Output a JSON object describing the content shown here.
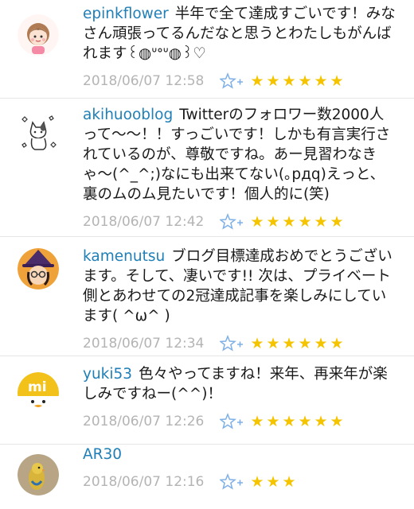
{
  "comments": [
    {
      "user": "epinkflower",
      "text": "半年で全て達成すごいです！みなさん頑張ってるんだなと思うとわたしもがんばれます꒰◍ᐡᐤᐡ◍꒱♡",
      "date": "2018/06/07 12:58",
      "stars": 6,
      "avatar_icon": "cartoon-girl-avatar"
    },
    {
      "user": "akihuooblog",
      "text": "Twitterのフォロワー数2000人って〜〜！！すっごいです！しかも有言実行されているのが、尊敬ですね。あー見習わなきゃ〜(^_^;)なにも出来てない(｡pдq)えっと、裏のムのム見たいです！個人的に(笑)",
      "date": "2018/06/07 12:42",
      "stars": 6,
      "avatar_icon": "cat-doodle-avatar"
    },
    {
      "user": "kamenutsu",
      "text": "ブログ目標達成おめでとうございます。そして、凄いです!! 次は、プライベート側とあわせての2冠達成記事を楽しみにしています( ^ω^ )",
      "date": "2018/06/07 12:34",
      "stars": 6,
      "avatar_icon": "witch-avatar"
    },
    {
      "user": "yuki53",
      "text": "色々やってますね！来年、再来年が楽しみですねー(^^)！",
      "date": "2018/06/07 12:26",
      "stars": 6,
      "avatar_icon": "mi-duck-avatar"
    },
    {
      "user": "AR30",
      "text": "",
      "date": "2018/06/07 12:16",
      "stars": 3,
      "avatar_icon": "bird-photo-avatar"
    }
  ],
  "colors": {
    "username": "#1f7fb6",
    "star": "#f5c400",
    "date": "#b4b4b4",
    "add_star": "#7fb0e6"
  },
  "icons": {
    "add_star": "add-star-icon",
    "star": "star-icon"
  }
}
